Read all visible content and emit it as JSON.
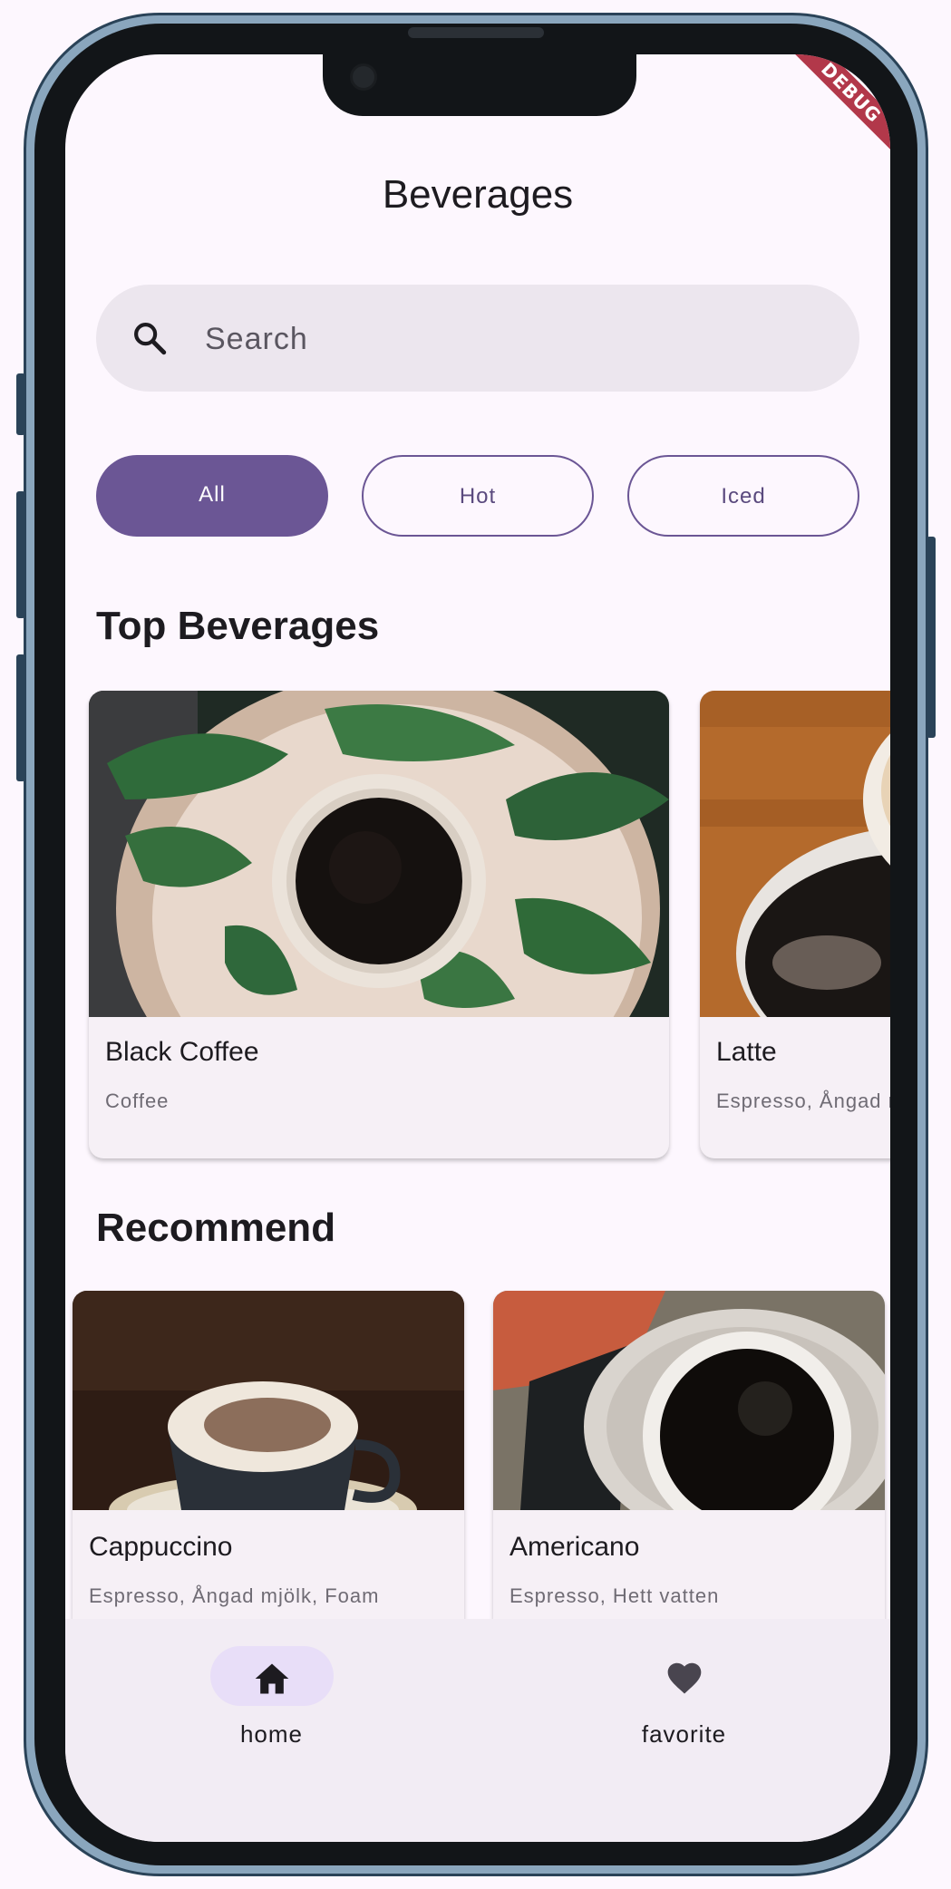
{
  "debug_banner": "DEBUG",
  "header": {
    "title": "Beverages"
  },
  "search": {
    "placeholder": "Search",
    "icon": "search-icon"
  },
  "filters": [
    {
      "label": "All",
      "selected": true
    },
    {
      "label": "Hot",
      "selected": false
    },
    {
      "label": "Iced",
      "selected": false
    }
  ],
  "sections": {
    "top": {
      "title": "Top Beverages",
      "items": [
        {
          "name": "Black Coffee",
          "ingredients": "Coffee"
        },
        {
          "name": "Latte",
          "ingredients": "Espresso, Ångad mjölk"
        }
      ]
    },
    "recommend": {
      "title": "Recommend",
      "items": [
        {
          "name": "Cappuccino",
          "ingredients": "Espresso, Ångad mjölk, Foam"
        },
        {
          "name": "Americano",
          "ingredients": "Espresso, Hett vatten"
        }
      ]
    }
  },
  "nav": [
    {
      "label": "home",
      "icon": "home-icon",
      "active": true
    },
    {
      "label": "favorite",
      "icon": "heart-icon",
      "active": false
    }
  ],
  "colors": {
    "accent": "#6b5695",
    "background": "#fdf7fe",
    "nav_indicator": "#e8def8"
  }
}
